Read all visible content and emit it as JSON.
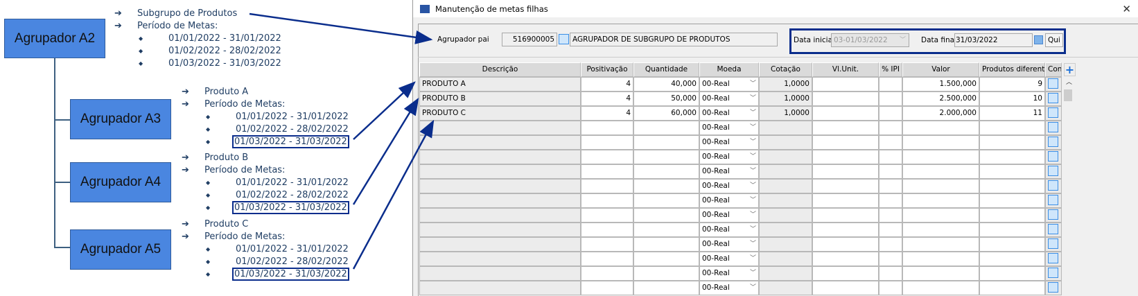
{
  "diagram": {
    "boxes": [
      "Agrupador A2",
      "Agrupador A3",
      "Agrupador A4",
      "Agrupador A5"
    ],
    "groups": [
      {
        "item": "Subgrupo de Produtos",
        "period_label": "Período de Metas:",
        "dates": [
          "01/01/2022 - 31/01/2022",
          "01/02/2022 - 28/02/2022",
          "01/03/2022 - 31/03/2022"
        ]
      },
      {
        "item": "Produto A",
        "period_label": "Período de Metas:",
        "dates": [
          "01/01/2022 - 31/01/2022",
          "01/02/2022 - 28/02/2022",
          "01/03/2022 - 31/03/2022"
        ]
      },
      {
        "item": "Produto B",
        "period_label": "Período de Metas:",
        "dates": [
          "01/01/2022 - 31/01/2022",
          "01/02/2022 - 28/02/2022",
          "01/03/2022 - 31/03/2022"
        ]
      },
      {
        "item": "Produto C",
        "period_label": "Período de Metas:",
        "dates": [
          "01/01/2022 - 31/01/2022",
          "01/02/2022 - 28/02/2022",
          "01/03/2022 - 31/03/2022"
        ]
      }
    ],
    "arrow_glyph": "➔",
    "bullet_glyph": "◆",
    "highlight_color": "#0a2d8c",
    "box_color": "#4a86e0"
  },
  "window": {
    "title": "Manutenção de metas filhas",
    "close": "✕",
    "agrupador_label": "Agrupador pai",
    "agrupador_code": "516900005",
    "agrupador_desc": "AGRUPADOR DE SUBGRUPO DE PRODUTOS",
    "data_inicial_label": "Data inicial",
    "data_inicial": "03-01/03/2022",
    "data_final_label": "Data final",
    "data_final": "31/03/2022",
    "qui_button": "Qui",
    "add": "+",
    "columns": [
      "Descrição",
      "Positivação",
      "Quantidade",
      "Moeda",
      "Cotação",
      "Vl.Unit.",
      "% IPI",
      "Valor",
      "Produtos diferentes",
      "Con."
    ],
    "rows": [
      {
        "descricao": "PRODUTO A",
        "positivacao": "4",
        "quantidade": "40,000",
        "moeda": "00-Real",
        "cotacao": "1,0000",
        "vl_unit": "",
        "ipi": "",
        "valor": "1.500,000",
        "produtos": "9"
      },
      {
        "descricao": "PRODUTO B",
        "positivacao": "4",
        "quantidade": "50,000",
        "moeda": "00-Real",
        "cotacao": "1,0000",
        "vl_unit": "",
        "ipi": "",
        "valor": "2.500,000",
        "produtos": "10"
      },
      {
        "descricao": "PRODUTO C",
        "positivacao": "4",
        "quantidade": "60,000",
        "moeda": "00-Real",
        "cotacao": "1,0000",
        "vl_unit": "",
        "ipi": "",
        "valor": "2.000,000",
        "produtos": "11"
      }
    ],
    "empty_moeda": "00-Real"
  }
}
